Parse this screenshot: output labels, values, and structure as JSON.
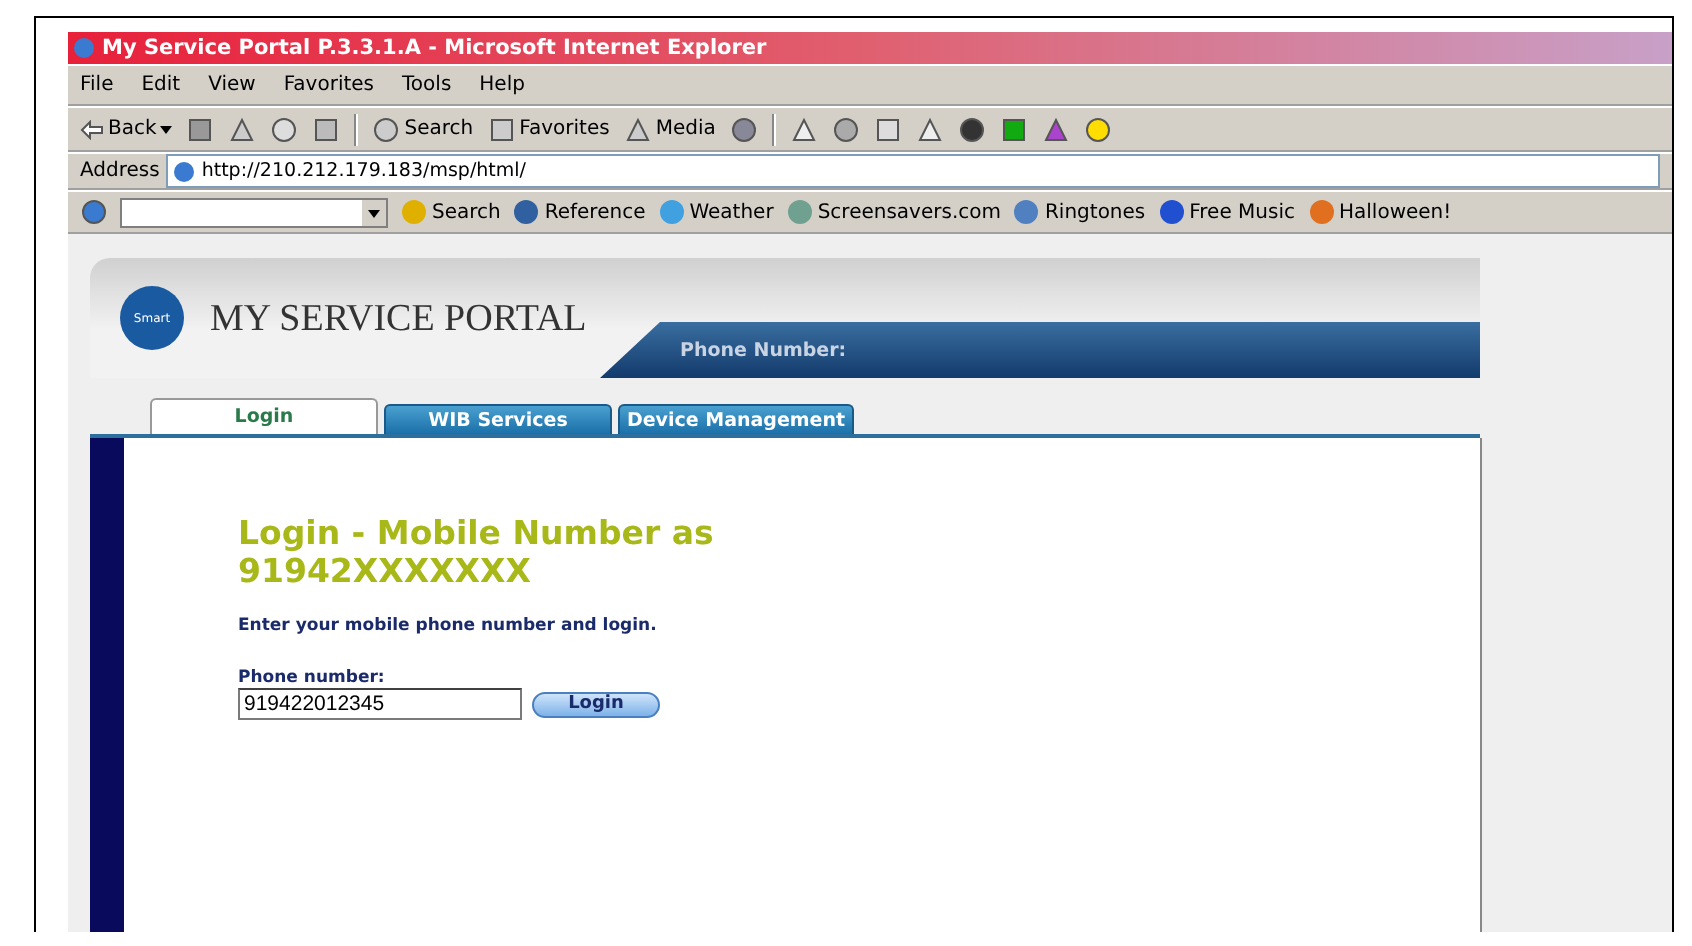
{
  "window": {
    "title": "My Service Portal P.3.3.1.A - Microsoft Internet Explorer"
  },
  "menu": [
    "File",
    "Edit",
    "View",
    "Favorites",
    "Tools",
    "Help"
  ],
  "toolbar": [
    {
      "kind": "back",
      "label": "Back"
    },
    {
      "kind": "icon"
    },
    {
      "kind": "icon"
    },
    {
      "kind": "icon"
    },
    {
      "kind": "icon"
    },
    {
      "kind": "sep"
    },
    {
      "kind": "text",
      "label": "Search"
    },
    {
      "kind": "text",
      "label": "Favorites"
    },
    {
      "kind": "text",
      "label": "Media"
    },
    {
      "kind": "icon"
    },
    {
      "kind": "sep"
    },
    {
      "kind": "icon"
    },
    {
      "kind": "icon"
    },
    {
      "kind": "icon"
    },
    {
      "kind": "icon"
    },
    {
      "kind": "icon"
    },
    {
      "kind": "icon"
    },
    {
      "kind": "icon"
    },
    {
      "kind": "icon"
    }
  ],
  "address": {
    "label": "Address",
    "url": "http://210.212.179.183/msp/html/"
  },
  "links": [
    {
      "label": "Search",
      "color": "#e0b000"
    },
    {
      "label": "Reference",
      "color": "#3060a0"
    },
    {
      "label": "Weather",
      "color": "#40a0e0"
    },
    {
      "label": "Screensavers.com",
      "color": "#70a090"
    },
    {
      "label": "Ringtones",
      "color": "#5080c0"
    },
    {
      "label": "Free Music",
      "color": "#2050d0"
    },
    {
      "label": "Halloween!",
      "color": "#e07020"
    }
  ],
  "portal": {
    "brand": "MY SERVICE PORTAL",
    "logo_text": "Smart",
    "phone_label": "Phone Number:",
    "tabs": [
      {
        "label": "Login",
        "selected": true
      },
      {
        "label": "WIB Services",
        "selected": false
      },
      {
        "label": "Device Management",
        "selected": false
      }
    ],
    "heading": "Login - Mobile Number as 91942XXXXXXX",
    "instruction": "Enter your mobile phone number and login.",
    "field": {
      "label": "Phone number:",
      "value": "919422012345"
    },
    "button": "Login"
  }
}
